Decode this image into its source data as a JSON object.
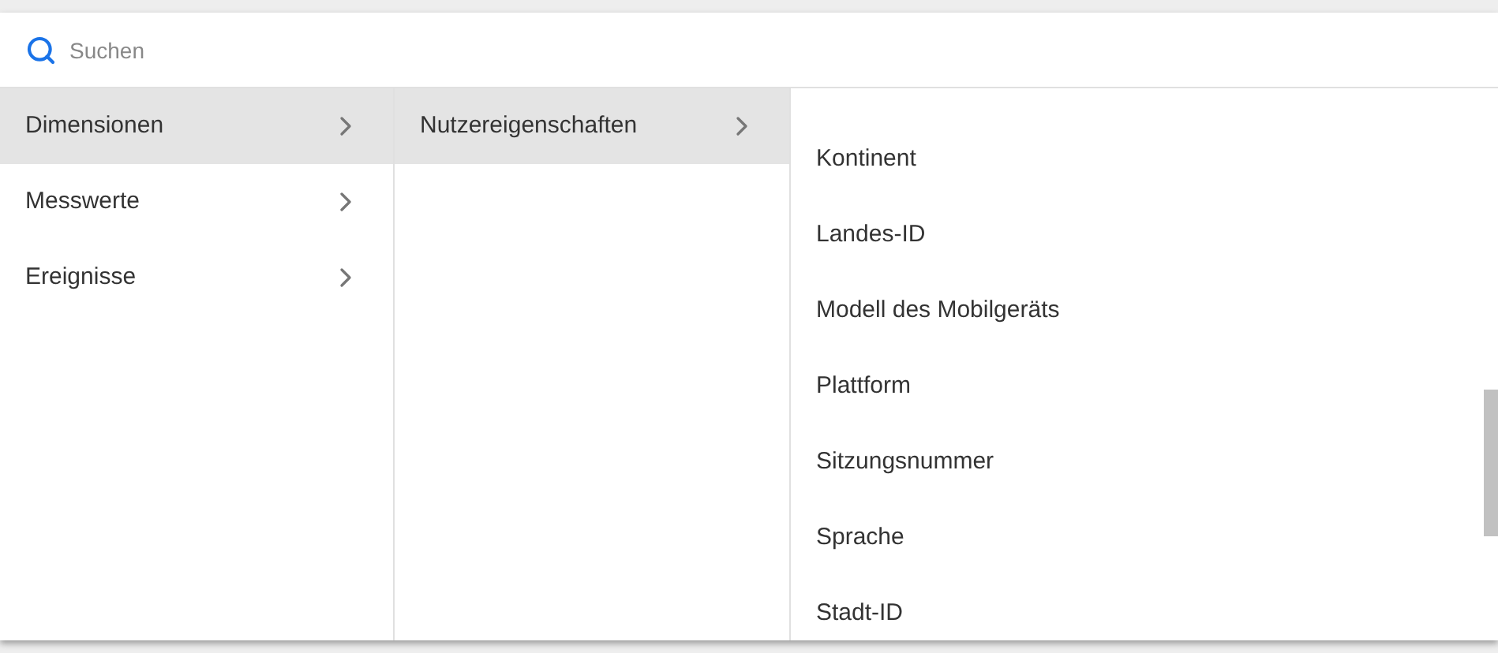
{
  "search": {
    "placeholder": "Suchen"
  },
  "categories": [
    {
      "label": "Dimensionen",
      "selected": true
    },
    {
      "label": "Messwerte",
      "selected": false
    },
    {
      "label": "Ereignisse",
      "selected": false
    }
  ],
  "groups": [
    {
      "label": "Nutzereigenschaften",
      "selected": true
    }
  ],
  "fields": [
    "Kontinent",
    "Landes-ID",
    "Modell des Mobilgeräts",
    "Plattform",
    "Sitzungsnummer",
    "Sprache",
    "Stadt-ID"
  ]
}
